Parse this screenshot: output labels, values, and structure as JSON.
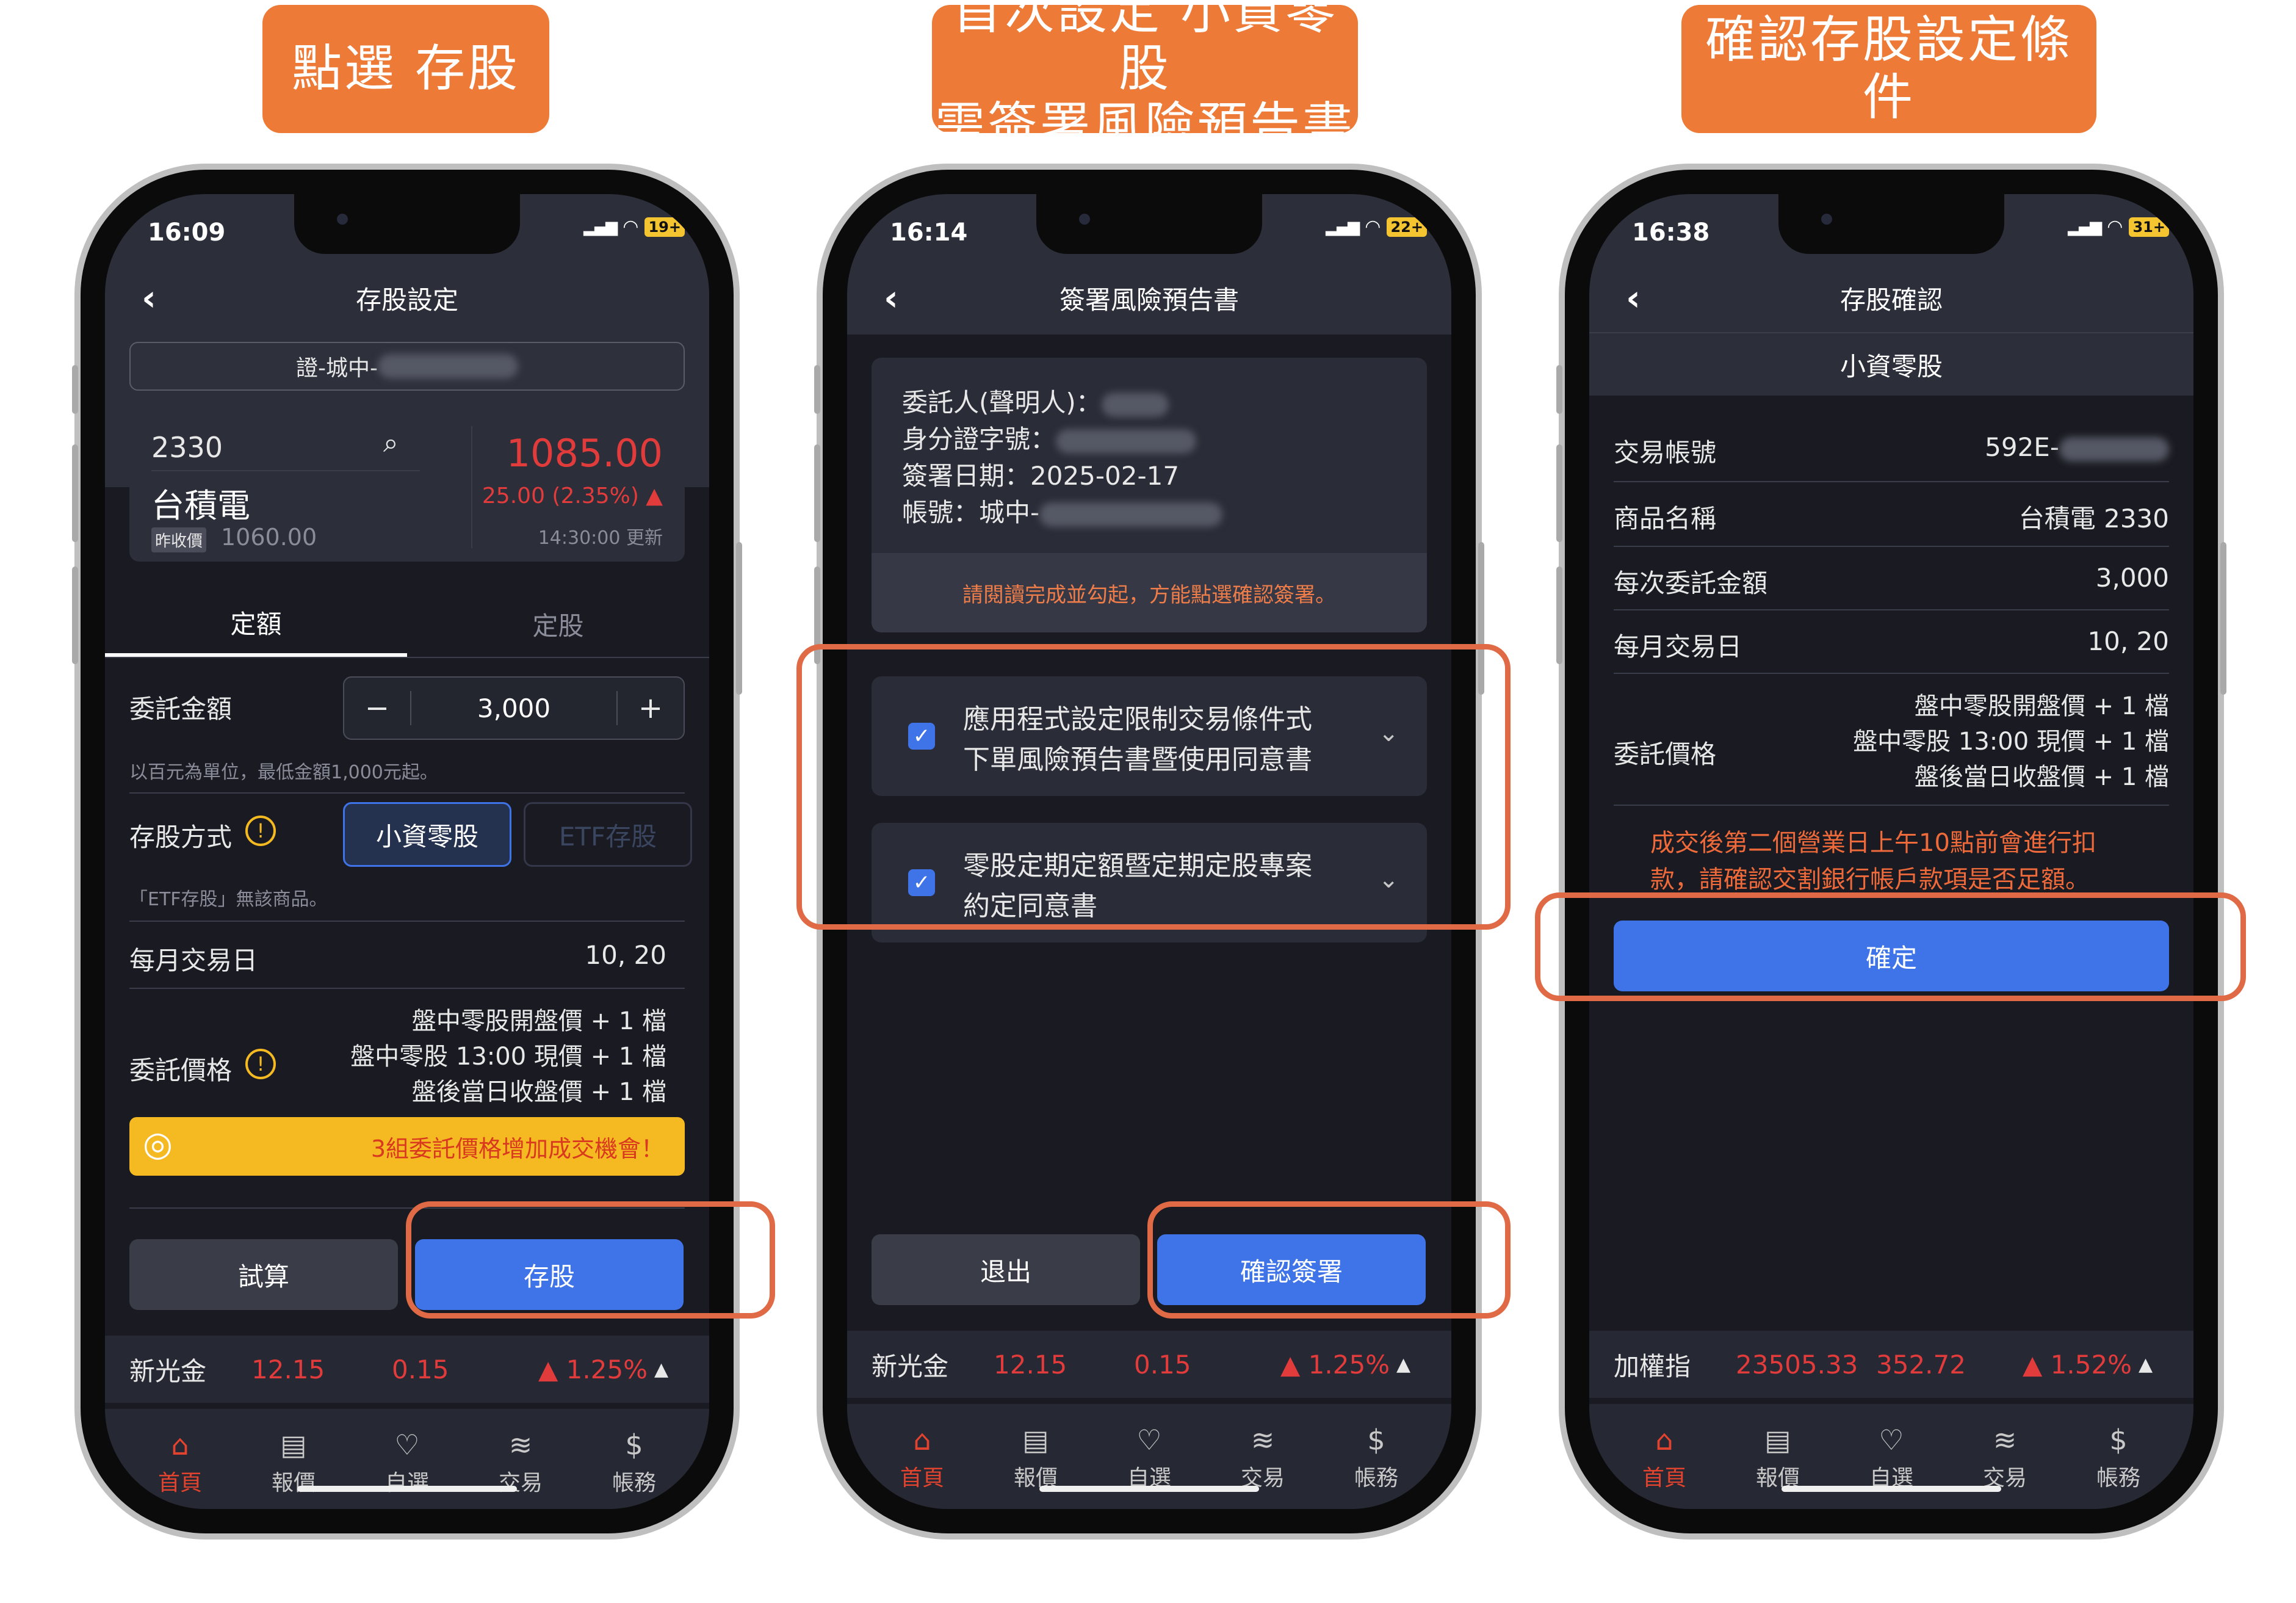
{
  "callouts": {
    "step1": [
      "點選 存股"
    ],
    "step2": [
      "首次設定 小資零股",
      "需簽署風險預告書"
    ],
    "step3": [
      "確認存股設定條件"
    ]
  },
  "colors": {
    "accent_orange": "#ed7a36",
    "primary_blue": "#3f74e8",
    "up_red": "#e23b3b",
    "highlight_yellow": "#f5b922"
  },
  "tabbar": [
    {
      "icon": "home-icon",
      "label": "首頁"
    },
    {
      "icon": "quote-icon",
      "label": "報價"
    },
    {
      "icon": "heart-icon",
      "label": "自選"
    },
    {
      "icon": "layers-icon",
      "label": "交易"
    },
    {
      "icon": "dollar-icon",
      "label": "帳務"
    }
  ],
  "screen1": {
    "time": "16:09",
    "battery": "19+",
    "title": "存股設定",
    "account": "證-城中-",
    "stock": {
      "code": "2330",
      "name": "台積電",
      "prev_label": "昨收價",
      "prev_close": "1060.00",
      "price": "1085.00",
      "change": "25.00 (2.35%) ▲",
      "updated": "14:30:00 更新"
    },
    "tabs": [
      "定額",
      "定股"
    ],
    "amount": {
      "label": "委託金額",
      "value": "3,000",
      "minus": "−",
      "plus": "+",
      "hint": "以百元為單位，最低金額1,000元起。"
    },
    "method": {
      "label": "存股方式",
      "opt1": "小資零股",
      "opt2": "ETF存股",
      "hint": "「ETF存股」無該商品。"
    },
    "trade_day": {
      "label": "每月交易日",
      "value": "10, 20"
    },
    "price": {
      "label": "委託價格",
      "lines": [
        "盤中零股開盤價 + 1 檔",
        "盤中零股 13:00 現價 + 1 檔",
        "盤後當日收盤價 + 1 檔"
      ]
    },
    "banner": "3組委託價格增加成交機會！",
    "buttons": {
      "calc": "試算",
      "save": "存股"
    },
    "ticker": {
      "name": "新光金",
      "price": "12.15",
      "change": "0.15",
      "pct": "▲ 1.25%"
    }
  },
  "screen2": {
    "time": "16:14",
    "battery": "22+",
    "title": "簽署風險預告書",
    "info": {
      "principal": "委託人(聲明人)：",
      "id": "身分證字號：",
      "date": "簽署日期：2025-02-17",
      "account": "帳號：城中-"
    },
    "notice": "請閱讀完成並勾起，方能點選確認簽署。",
    "docs": [
      [
        "應用程式設定限制交易條件式",
        "下單風險預告書暨使用同意書"
      ],
      [
        "零股定期定額暨定期定股專案",
        "約定同意書"
      ]
    ],
    "buttons": {
      "exit": "退出",
      "confirm": "確認簽署"
    },
    "ticker": {
      "name": "新光金",
      "price": "12.15",
      "change": "0.15",
      "pct": "▲ 1.25%"
    }
  },
  "screen3": {
    "time": "16:38",
    "battery": "31+",
    "title": "存股確認",
    "subtitle": "小資零股",
    "rows": [
      {
        "label": "交易帳號",
        "value": "592E-"
      },
      {
        "label": "商品名稱",
        "value": "台積電 2330"
      },
      {
        "label": "每次委託金額",
        "value": "3,000"
      },
      {
        "label": "每月交易日",
        "value": "10, 20"
      }
    ],
    "price": {
      "label": "委託價格",
      "lines": [
        "盤中零股開盤價 + 1 檔",
        "盤中零股 13:00 現價 + 1 檔",
        "盤後當日收盤價 + 1 檔"
      ]
    },
    "warning": [
      "成交後第二個營業日上午10點前會進行扣",
      "款，請確認交割銀行帳戶款項是否足額。"
    ],
    "ok": "確定",
    "ticker": {
      "name": "加權指",
      "price": "23505.33",
      "change": "352.72",
      "pct": "▲ 1.52%"
    }
  }
}
